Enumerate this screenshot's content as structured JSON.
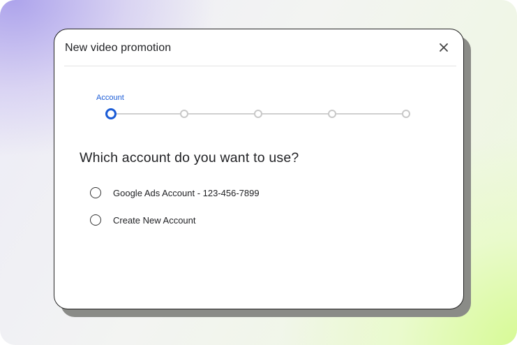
{
  "dialog": {
    "title": "New video promotion",
    "close_icon": "close-icon"
  },
  "stepper": {
    "current_label": "Account",
    "current_step": 1,
    "total_steps": 5
  },
  "question": "Which account do you want to use?",
  "options": [
    {
      "label": "Google Ads Account - 123-456-7899",
      "selected": false
    },
    {
      "label": "Create New Account",
      "selected": false
    }
  ],
  "colors": {
    "accent": "#1a5bd6",
    "inactive_step": "#c8c8c8",
    "text": "#202124"
  }
}
